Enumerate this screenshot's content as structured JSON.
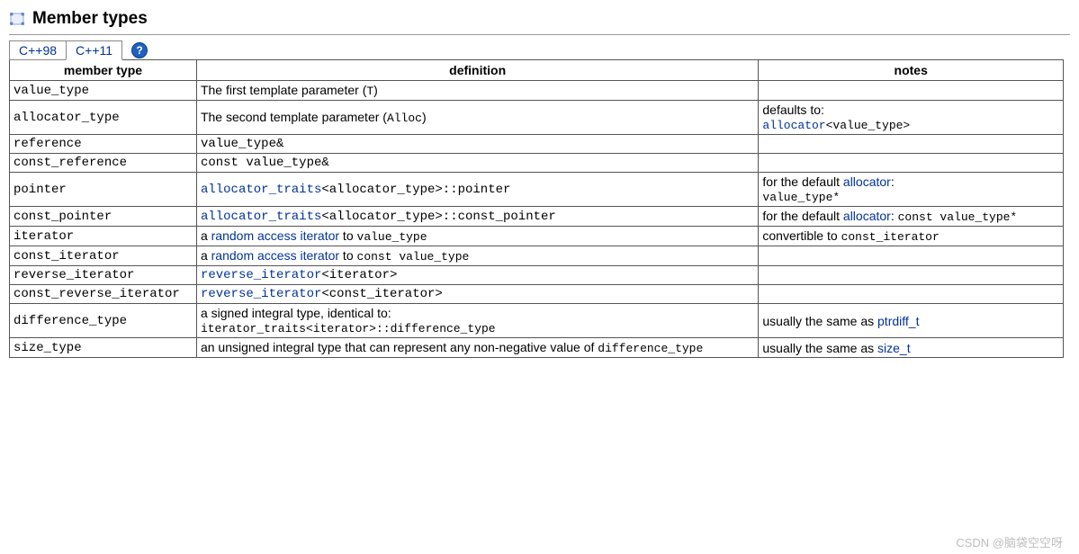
{
  "section": {
    "title": "Member types"
  },
  "tabs": {
    "cpp98": "C++98",
    "cpp11": "C++11",
    "help": "?"
  },
  "headers": {
    "member_type": "member type",
    "definition": "definition",
    "notes": "notes"
  },
  "rows": {
    "value_type": {
      "name": "value_type",
      "def_pre": "The first template parameter (",
      "def_code": "T",
      "def_post": ")"
    },
    "allocator_type": {
      "name": "allocator_type",
      "def_pre": "The second template parameter (",
      "def_code": "Alloc",
      "def_post": ")",
      "notes_pre": "defaults to: ",
      "notes_link": "allocator",
      "notes_code": "<value_type>"
    },
    "reference": {
      "name": "reference",
      "def_code": "value_type&"
    },
    "const_reference": {
      "name": "const_reference",
      "def_code": "const value_type&"
    },
    "pointer": {
      "name": "pointer",
      "def_link": "allocator_traits",
      "def_code": "<allocator_type>::pointer",
      "notes_pre": "for the default ",
      "notes_link": "allocator",
      "notes_post": ": ",
      "notes_code": "value_type*"
    },
    "const_pointer": {
      "name": "const_pointer",
      "def_link": "allocator_traits",
      "def_code": "<allocator_type>::const_pointer",
      "notes_pre": "for the default ",
      "notes_link": "allocator",
      "notes_post": ": ",
      "notes_code": "const value_type*"
    },
    "iterator": {
      "name": "iterator",
      "def_pre": "a ",
      "def_link": "random access iterator",
      "def_mid": " to ",
      "def_code": "value_type",
      "notes_pre": "convertible to ",
      "notes_code": "const_iterator"
    },
    "const_iterator": {
      "name": "const_iterator",
      "def_pre": "a ",
      "def_link": "random access iterator",
      "def_mid": " to ",
      "def_code": "const value_type"
    },
    "reverse_iterator": {
      "name": "reverse_iterator",
      "def_link": "reverse_iterator",
      "def_code": "<iterator>"
    },
    "const_reverse_iterator": {
      "name": "const_reverse_iterator",
      "def_link": "reverse_iterator",
      "def_code": "<const_iterator>"
    },
    "difference_type": {
      "name": "difference_type",
      "def_pre": "a signed integral type, identical to:",
      "def_code": "iterator_traits<iterator>::difference_type",
      "notes_pre": "usually the same as ",
      "notes_link": "ptrdiff_t"
    },
    "size_type": {
      "name": "size_type",
      "def_pre": "an unsigned integral type that can represent any non-negative value of ",
      "def_code": "difference_type",
      "notes_pre": "usually the same as ",
      "notes_link": "size_t"
    }
  },
  "watermark": "CSDN @脑袋空空呀"
}
